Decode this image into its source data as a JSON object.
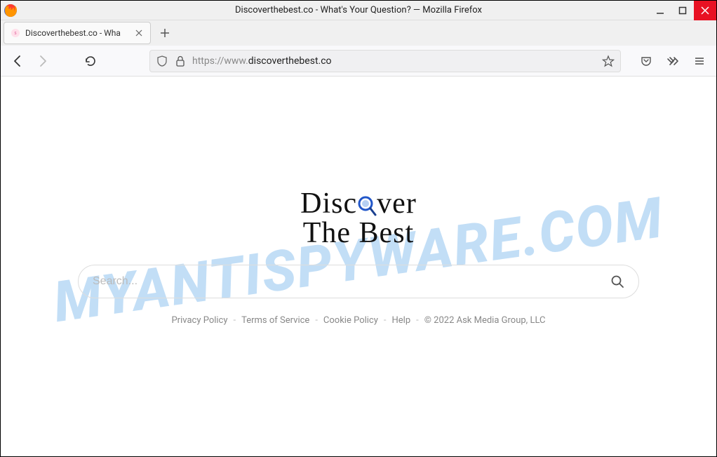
{
  "window": {
    "title": "Discoverthebest.co - What's Your Question? — Mozilla Firefox"
  },
  "tab": {
    "title": "Discoverthebest.co - Wha"
  },
  "url": {
    "prefix": "https://www.",
    "domain": "discoverthebest.co",
    "suffix": ""
  },
  "page": {
    "logo_line1_a": "Disc",
    "logo_line1_b": "ver",
    "logo_line2": "The Best",
    "search_placeholder": "Search..."
  },
  "footer": {
    "links": [
      "Privacy Policy",
      "Terms of Service",
      "Cookie Policy",
      "Help"
    ],
    "copyright": "© 2022 Ask Media Group, LLC"
  },
  "watermark": "MYANTISPYWARE.COM"
}
